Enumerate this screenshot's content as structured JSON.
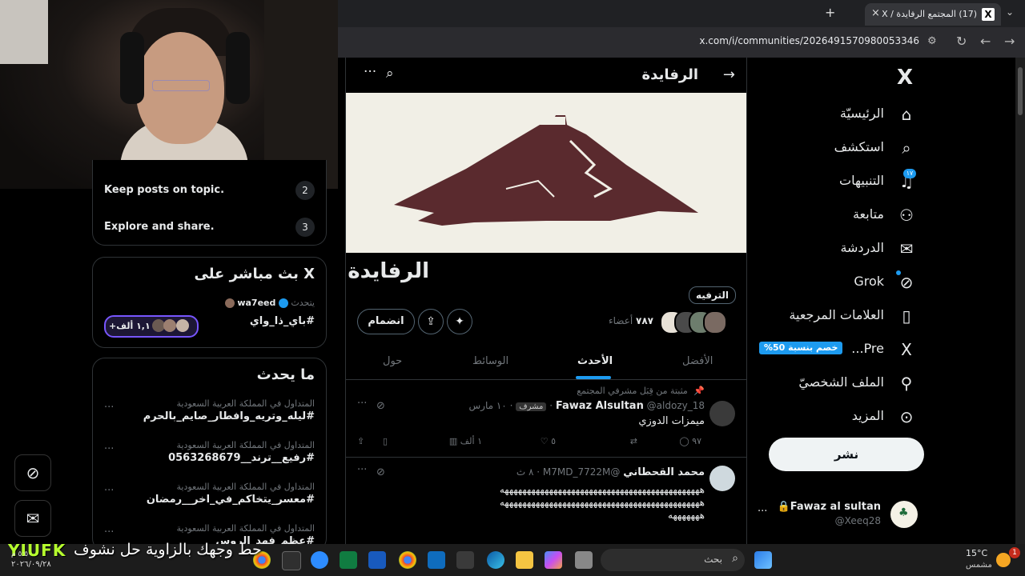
{
  "browser": {
    "tab_title": "(17) المجتمع الرفايدة / X",
    "tab_close": "×",
    "new_tab": "+",
    "url": "x.com/i/communities/2026491570980053346"
  },
  "left": {
    "rules": [
      {
        "num": "2",
        "text": "Keep posts on topic."
      },
      {
        "num": "3",
        "text": "Explore and share."
      }
    ],
    "live": {
      "title": "X بث مباشر على",
      "host_prefix": "يتحدث",
      "host": "wa7eed",
      "topic": "#باي_ذا_واي",
      "listeners": "+١,١ ألف"
    },
    "happening": {
      "title": "ما يحدث",
      "trends": [
        {
          "context": "المتداول في المملكة العربية السعودية",
          "tag": "#ليله_وتريه_وافطار_صايم_بالحرم"
        },
        {
          "context": "المتداول في المملكة العربية السعودية",
          "tag": "#رفيع__ترند__0563268679"
        },
        {
          "context": "المتداول في المملكة العربية السعودية",
          "tag": "#معسر_يتخاكم_في_اخر__رمضان"
        },
        {
          "context": "المتداول في المملكة العربية السعودية",
          "tag": "#عظم_فهد_الروس"
        }
      ],
      "more": "···"
    }
  },
  "center": {
    "header_title": "الرفايدة",
    "community_name": "الرفايدة",
    "category_chip": "الترفيه",
    "members_count": "٧٨٧",
    "members_label": "أعضاء",
    "join_label": "انضمام",
    "tabs": [
      "الأفضل",
      "الأحدث",
      "الوسائط",
      "حول"
    ],
    "posts": [
      {
        "pinned_label": "مثبتة من قِبَل مشرفي المجتمع",
        "name": "Fawaz Alsultan",
        "handle": "@aldozy_18",
        "role": "مشرف",
        "time": "١٠ مارس",
        "text": "ميمزات الدوزي",
        "replies": "٩٧",
        "likes": "٥",
        "views": "١ ألف"
      },
      {
        "name": "محمد القحطاني",
        "handle": "@M7MD_7722M",
        "time": "٨ ث",
        "text_line1": "هههههههههههههههههههههههههههههههههههههههههههههه",
        "text_line2": "هههههههههههههههههههههههههههههههههههههههههههههه",
        "text_line3": "هههههههه"
      }
    ]
  },
  "nav": {
    "items": [
      "الرئيسيّة",
      "استكشف",
      "التنبيهات",
      "متابعة",
      "الدردشة",
      "Grok",
      "العلامات المرجعية",
      "Pre...",
      "الملف الشخصيّ",
      "المزيد"
    ],
    "notif_badge": "١٧",
    "premium_promo": "%خصم بنسبة 50",
    "post_button": "نشر",
    "account_name": "Fawaz al sultan",
    "account_handle": "@Xeeq28",
    "account_more": "···"
  },
  "overlay": {
    "brand": "YIUFK",
    "caption": "حط وجهك بالزاوية حل نشوف",
    "time_small": "٥:٥٠ م",
    "date_small": "٢٠٢٦/٠٩/٢٨"
  },
  "taskbar": {
    "search_placeholder": "بحث",
    "weather_temp": "15°C",
    "weather_desc": "مشمس",
    "notif_count": "1"
  },
  "colors": {
    "accent": "#1d9bf0",
    "banner_mountain": "#5a2a2e",
    "banner_bg": "#f1efe6"
  }
}
